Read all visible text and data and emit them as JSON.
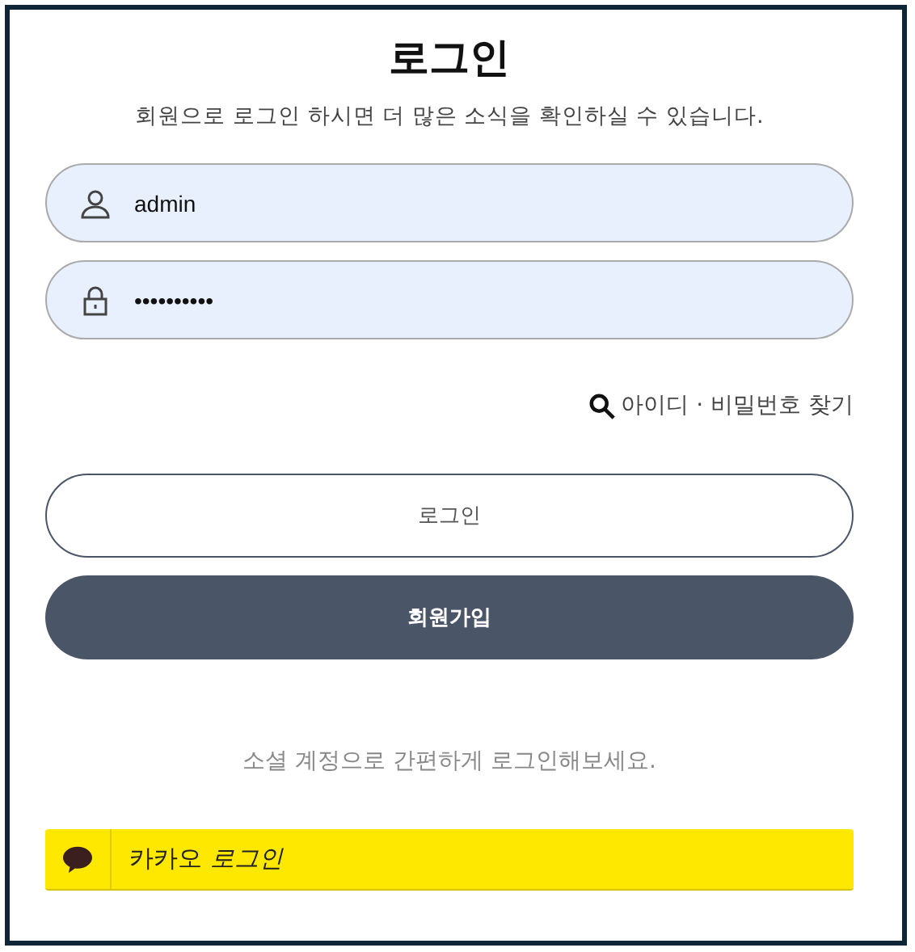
{
  "title": "로그인",
  "subtitle": "회원으로 로그인 하시면 더 많은 소식을 확인하실 수 있습니다.",
  "fields": [
    {
      "kind": "user",
      "value": "admin"
    },
    {
      "kind": "password",
      "value": "••••••••••"
    }
  ],
  "find_link": "아이디 · 비밀번호 찾기",
  "buttons": [
    {
      "kind": "outline",
      "label": "로그인"
    },
    {
      "kind": "filled",
      "label": "회원가입"
    }
  ],
  "social_text": "소셜 계정으로 간편하게 로그인해보세요.",
  "kakao_button": {
    "label": "카카오 *로그인*"
  }
}
